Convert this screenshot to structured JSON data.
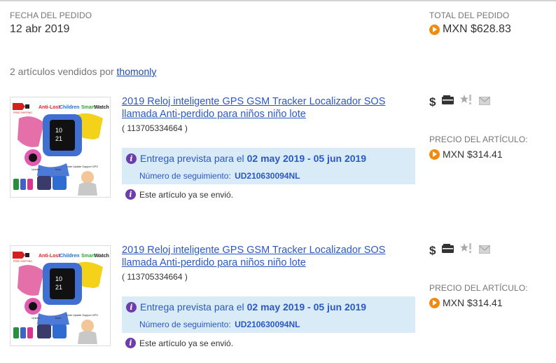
{
  "order": {
    "date_label": "FECHA DEL PEDIDO",
    "date_value": "12 abr 2019",
    "total_label": "TOTAL DEL PEDIDO",
    "total_value": "MXN $628.83"
  },
  "seller": {
    "prefix": "2 artículos vendidos por",
    "name": "thomonly"
  },
  "items": [
    {
      "title": "2019 Reloj inteligente GPS GSM Tracker Localizador SOS llamada Anti-perdido para niños niño lote",
      "item_number": "( 113705334664 )",
      "delivery_prefix": "Entrega prevista para el",
      "delivery_dates": "02 may 2019 - 05 jun 2019",
      "tracking_label": "Número de seguimiento:",
      "tracking_number": "UD210630094NL",
      "shipped_text": "Este artículo ya se envió.",
      "price_label": "PRECIO DEL ARTÍCULO:",
      "price_value": "MXN $314.41",
      "image_text": {
        "free": "FREE SHIPPING",
        "headline_1": "Anti-Lost",
        "headline_2": "Children",
        "headline_3": "Smart",
        "headline_4": "Watch",
        "update": "Upstate",
        "basic": "Basic",
        "note": "Note Update Support GPS"
      }
    },
    {
      "title": "2019 Reloj inteligente GPS GSM Tracker Localizador SOS llamada Anti-perdido para niños niño lote",
      "item_number": "( 113705334664 )",
      "delivery_prefix": "Entrega prevista para el",
      "delivery_dates": "02 may 2019 - 05 jun 2019",
      "tracking_label": "Número de seguimiento:",
      "tracking_number": "UD210630094NL",
      "shipped_text": "Este artículo ya se envió.",
      "price_label": "PRECIO DEL ARTÍCULO:",
      "price_value": "MXN $314.41",
      "image_text": {
        "free": "FREE SHIPPING",
        "headline_1": "Anti-Lost",
        "headline_2": "Children",
        "headline_3": "Smart",
        "headline_4": "Watch",
        "update": "Upstate",
        "basic": "Basic",
        "note": "Note Update Support GPS"
      }
    }
  ],
  "icons": {
    "currency": "dollar-icon",
    "coin": "orange-play-coin-icon",
    "info": "info-icon",
    "wallet": "wallet-icon",
    "feedback": "star-feedback-icon",
    "message": "envelope-icon"
  },
  "colors": {
    "link": "#2c58c4",
    "delivery_bg": "#d8ebf6",
    "info_icon": "#6e3dab",
    "coin": "#f28a0e"
  }
}
